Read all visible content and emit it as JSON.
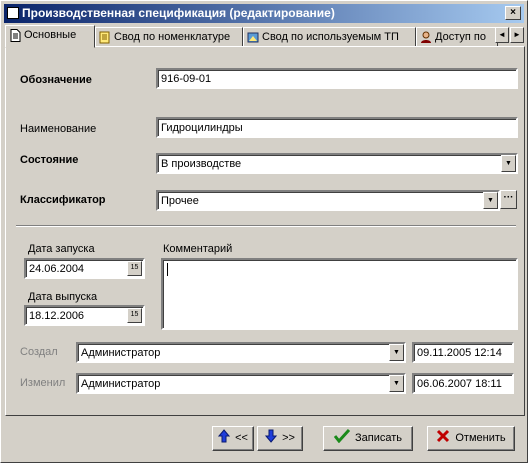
{
  "window": {
    "title": "Производственная спецификация (редактирование)",
    "close_glyph": "×"
  },
  "tabs": [
    {
      "label": "Основные",
      "icon": "document-icon"
    },
    {
      "label": "Свод по номенклатуре",
      "icon": "summary-icon"
    },
    {
      "label": "Свод по используемым ТП",
      "icon": "tp-icon"
    },
    {
      "label": "Доступ по",
      "icon": "user-icon"
    }
  ],
  "tab_scroll": {
    "left": "◄",
    "right": "►"
  },
  "form": {
    "designation": {
      "label": "Обозначение",
      "value": "916-09-01"
    },
    "name": {
      "label": "Наименование",
      "value": "Гидроцилиндры"
    },
    "state": {
      "label": "Состояние",
      "value": "В производстве"
    },
    "classifier": {
      "label": "Классификатор",
      "value": "Прочее",
      "ellipsis": "···"
    },
    "launch_date": {
      "label": "Дата запуска",
      "value": "24.06.2004"
    },
    "release_date": {
      "label": "Дата выпуска",
      "value": "18.12.2006"
    },
    "comment": {
      "label": "Комментарий",
      "value": ""
    },
    "created": {
      "label": "Создал",
      "user": "Администратор",
      "datetime": "09.11.2005 12:14"
    },
    "modified": {
      "label": "Изменил",
      "user": "Администратор",
      "datetime": "06.06.2007 18:11"
    },
    "calendar_glyph": "15",
    "dropdown_glyph": "▼"
  },
  "buttons": {
    "prev": "<<",
    "next": ">>",
    "save": "Записать",
    "cancel": "Отменить"
  },
  "colors": {
    "title_start": "#0a246a",
    "title_end": "#a6caf0",
    "nav_arrow": "#1f3ddb",
    "save_check": "#1a8a1a",
    "cancel_x": "#c00000"
  }
}
